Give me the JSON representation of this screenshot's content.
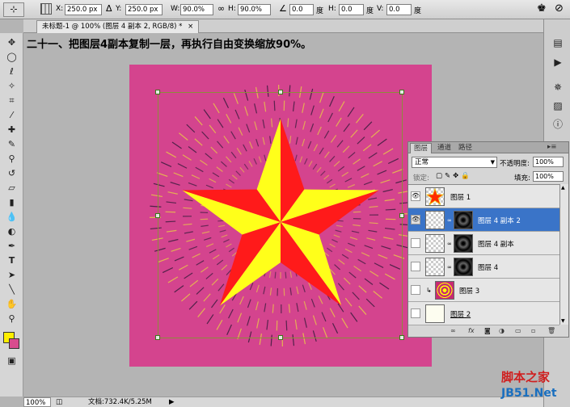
{
  "options_bar": {
    "x_label": "X:",
    "x_value": "250.0 px",
    "y_label": "Y:",
    "y_value": "250.0 px",
    "w_label": "W:",
    "w_value": "90.0%",
    "h_label": "H:",
    "h_value": "90.0%",
    "rot_value": "0.0",
    "rot_unit": "度",
    "hskew_label": "H:",
    "hskew_value": "0.0",
    "hskew_unit": "度",
    "vskew_label": "V:",
    "vskew_value": "0.0",
    "vskew_unit": "度"
  },
  "document_tab": {
    "title": "未标题-1 @ 100% (图层 4 副本 2, RGB/8) *",
    "close": "×"
  },
  "caption": "二十一、把图层4副本复制一层，再执行自由变换缩放90%。",
  "status_bar": {
    "zoom": "100%",
    "doc_info": "文档:732.4K/5.25M"
  },
  "colors": {
    "foreground": "#ffee00",
    "background": "#d84c8e",
    "canvas": "#d4448e",
    "star_red": "#ff1a1a",
    "star_yellow": "#ffff1a",
    "selected_layer": "#3a74c8"
  },
  "layers_panel": {
    "tabs": [
      "图层",
      "通道",
      "路径"
    ],
    "blend_mode": "正常",
    "opacity_label": "不透明度:",
    "opacity_value": "100%",
    "lock_label": "锁定:",
    "fill_label": "填充:",
    "fill_value": "100%",
    "layers": [
      {
        "name": "图层 1",
        "visible": true,
        "selected": false
      },
      {
        "name": "图层 4 副本 2",
        "visible": true,
        "selected": true
      },
      {
        "name": "图层 4 副本",
        "visible": false,
        "selected": false
      },
      {
        "name": "图层 4",
        "visible": false,
        "selected": false
      },
      {
        "name": "图层 3",
        "visible": false,
        "selected": false
      },
      {
        "name": "图层 2",
        "visible": false,
        "selected": false
      }
    ],
    "bottom_icons": [
      "link-icon",
      "fx-icon",
      "mask-icon",
      "adjustment-icon",
      "group-icon",
      "new-layer-icon",
      "trash-icon"
    ]
  },
  "watermark": {
    "line1": "脚本之家",
    "line2": "JB51.Net"
  }
}
